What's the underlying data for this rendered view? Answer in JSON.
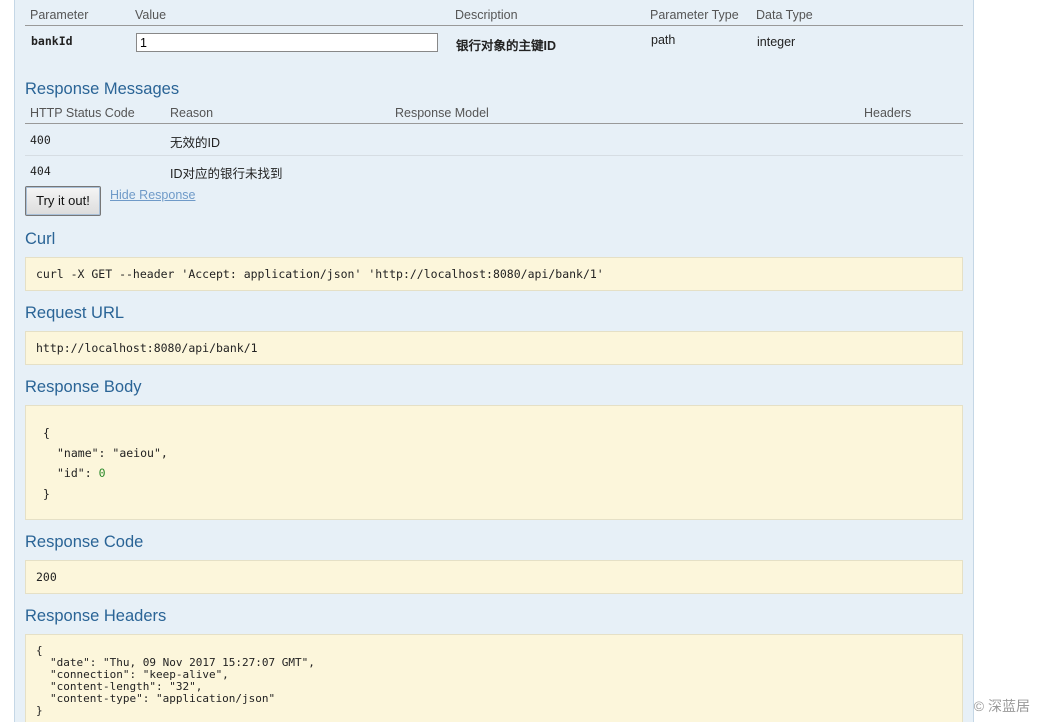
{
  "parameters": {
    "headers": [
      "Parameter",
      "Value",
      "Description",
      "Parameter Type",
      "Data Type"
    ],
    "rows": [
      {
        "name": "bankId",
        "value": "1",
        "description": "银行对象的主键ID",
        "param_type": "path",
        "data_type": "integer"
      }
    ]
  },
  "response_messages": {
    "title": "Response Messages",
    "headers": [
      "HTTP Status Code",
      "Reason",
      "Response Model",
      "Headers"
    ],
    "rows": [
      {
        "code": "400",
        "reason": "无效的ID"
      },
      {
        "code": "404",
        "reason": "ID对应的银行未找到"
      }
    ]
  },
  "actions": {
    "try_label": "Try it out!",
    "hide_label": "Hide Response"
  },
  "curl": {
    "title": "Curl",
    "command": "curl -X GET --header 'Accept: application/json' 'http://localhost:8080/api/bank/1'"
  },
  "request_url": {
    "title": "Request URL",
    "url": "http://localhost:8080/api/bank/1"
  },
  "response_body": {
    "title": "Response Body",
    "open": "{",
    "name_key": "\"name\"",
    "name_val": "\"aeiou\"",
    "id_key": "\"id\"",
    "id_val": "0",
    "close": "}"
  },
  "response_code": {
    "title": "Response Code",
    "code": "200"
  },
  "response_headers": {
    "title": "Response Headers",
    "open": "{",
    "lines": [
      "\"date\": \"Thu, 09 Nov 2017 15:27:07 GMT\",",
      "\"connection\": \"keep-alive\",",
      "\"content-length\": \"32\",",
      "\"content-type\": \"application/json\""
    ],
    "close": "}"
  },
  "watermark": "© 深蓝居"
}
